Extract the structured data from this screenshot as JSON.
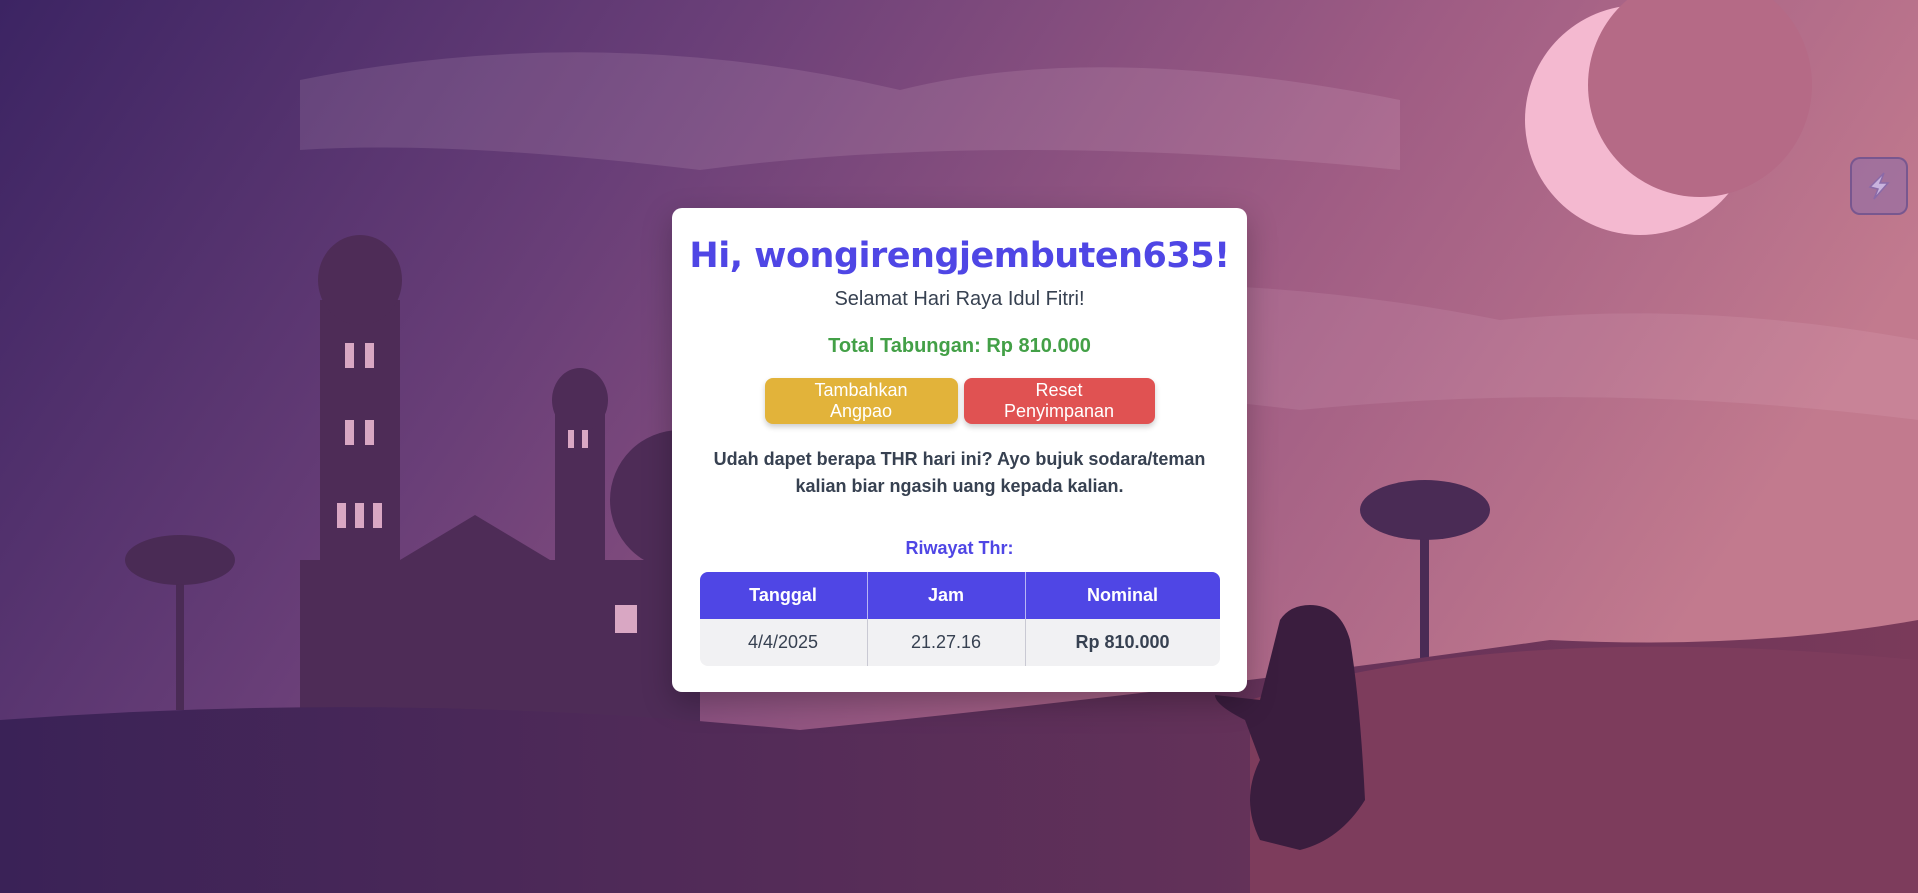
{
  "card": {
    "greeting": "Hi, wongirengjembuten635!",
    "subtitle": "Selamat Hari Raya Idul Fitri!",
    "total_label": "Total Tabungan:",
    "total_value": "Rp 810.000",
    "add_button": "Tambahkan Angpao",
    "reset_button": "Reset Penyimpanan",
    "message": "Udah dapet berapa THR hari ini? Ayo bujuk sodara/teman kalian biar ngasih uang kepada kalian.",
    "history_title": "Riwayat Thr:",
    "table": {
      "headers": [
        "Tanggal",
        "Jam",
        "Nominal"
      ],
      "rows": [
        [
          "4/4/2025",
          "21.27.16",
          "Rp 810.000"
        ]
      ]
    }
  },
  "side_button": {
    "icon": "lightning-icon"
  },
  "colors": {
    "accent": "#4f46e5",
    "money": "#43a047",
    "add_button": "#e2b33a",
    "reset_button": "#e05252"
  }
}
